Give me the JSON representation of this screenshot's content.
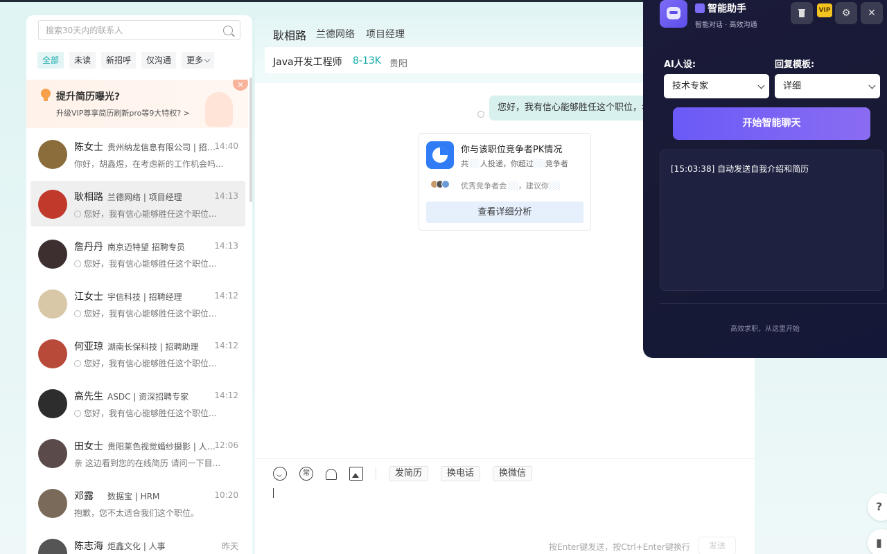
{
  "left": {
    "search_placeholder": "搜索30天内的联系人",
    "filters": [
      "全部",
      "未读",
      "新招呼",
      "仅沟通",
      "更多"
    ],
    "promo": {
      "title": "提升简历曝光?",
      "subtitle": "升级VIP尊享简历刷新pro等9大特权?  >"
    },
    "contacts": [
      {
        "name": "陈女士",
        "company": "贵州纳龙信息有限公司 | 招聘...",
        "time": "14:40",
        "message": "你好，胡鑫煜，在考虑新的工作机会吗..."
      },
      {
        "name": "耿相路",
        "company": "兰德网络 | 项目经理",
        "time": "14:13",
        "message": "您好，我有信心能够胜任这个职位..."
      },
      {
        "name": "詹丹丹",
        "company": "南京迈特望  招聘专员",
        "time": "14:13",
        "message": "您好，我有信心能够胜任这个职位..."
      },
      {
        "name": "江女士",
        "company": "宇信科技 | 招聘经理",
        "time": "14:12",
        "message": "您好，我有信心能够胜任这个职位..."
      },
      {
        "name": "何亚琼",
        "company": "湖南长保科技 | 招聘助理",
        "time": "14:12",
        "message": "您好，我有信心能够胜任这个职位..."
      },
      {
        "name": "高先生",
        "company": "ASDC | 资深招聘专家",
        "time": "14:12",
        "message": "您好，我有信心能够胜任这个职位..."
      },
      {
        "name": "田女士",
        "company": "贵阳莱色视觉婚纱摄影 | 人资...",
        "time": "12:06",
        "message": "亲 这边看到您的在线简历 请问一下目..."
      },
      {
        "name": "邓露",
        "company": "数据宝 | HRM",
        "time": "10:20",
        "message": "抱歉，您不太适合我们这个职位。"
      },
      {
        "name": "陈志海",
        "company": "炬鑫文化 | 人事",
        "time": "昨天",
        "message": ""
      }
    ],
    "avatar_colors": [
      "#8a6d3b",
      "#c0392b",
      "#3d2f2f",
      "#d8c8a8",
      "#b84a3a",
      "#2d2d2d",
      "#5a4a4a",
      "#7a6a5a",
      "#555555"
    ]
  },
  "chat": {
    "name": "耿相路",
    "company": "兰德网络",
    "role": "项目经理",
    "job_title": "Java开发工程师",
    "salary": "8-13K",
    "city": "贵阳",
    "bubble": "您好，我有信心能够胜任这个职位，希",
    "pk": {
      "title": "你与该职位竞争者PK情况",
      "sub_a": "共",
      "sub_b": "人投递，你超过",
      "sub_c": "竞争者",
      "sub2_a": "优秀竞争者会",
      "sub2_b": "，建议你",
      "button": "查看详细分析"
    },
    "tools": {
      "chang": "常"
    },
    "tags": [
      "发简历",
      "换电话",
      "换微信"
    ],
    "send_hint": "按Enter键发送，按Ctrl+Enter键换行",
    "send_button": "发送"
  },
  "ai": {
    "title": "智能助手",
    "subtitle": "智能对话 · 高效沟通",
    "vip": "VIP",
    "persona_label": "AI人设:",
    "persona_value": "技术专家",
    "template_label": "回复模板:",
    "template_value": "详细",
    "start_button": "开始智能聊天",
    "log": "[15:03:38] 自动发送自我介绍和简历",
    "footer": "高效求职，从这里开始",
    "icons": {
      "settings": "⚙",
      "close": "✕"
    }
  },
  "float": {
    "help": "?"
  }
}
